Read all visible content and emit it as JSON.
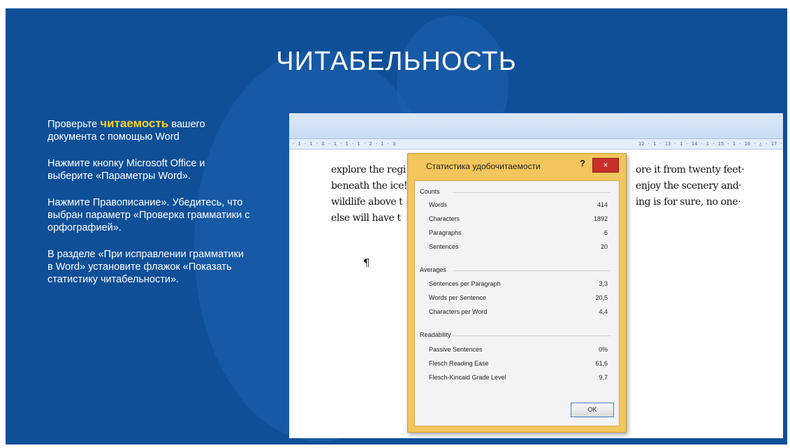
{
  "slide": {
    "title": "ЧИТАБЕЛЬНОСТЬ",
    "background_color": "#0e4f98",
    "highlight_color": "#ffd21a",
    "instructions": [
      {
        "prefix": "Проверьте ",
        "highlight": "читаемость",
        "suffix": " вашего документа с помощью Word"
      },
      {
        "text": "Нажмите кнопку Microsoft  Office и выберите «Параметры Word»."
      },
      {
        "text": "Нажмите Правописание». Убедитесь,  что выбран параметр «Проверка грамматики с орфографией»."
      },
      {
        "text": "В разделе «При исправлении грамматики в Word» установите флажок «Показать статистику читабельности»."
      }
    ]
  },
  "word": {
    "ruler_left": "· 1 · 1 · ⧖ · 1 · 1 · 1 · 2 · 1 · 3",
    "ruler_right": "12 · 1 · 13 · 1 · 14 · 1 · 15 · 1 · 16 · △ · 17 · 1 ·",
    "doc_lines_left": [
      "explore the regi",
      "beneath the ice!",
      "wildlife above t",
      "else will have t"
    ],
    "doc_lines_right": [
      "ore it from twenty feet·",
      "enjoy the scenery and·",
      "ing is for sure, no one·"
    ],
    "pilcrow": "¶"
  },
  "dialog": {
    "title": "Статистика удобочитаемости",
    "help_label": "?",
    "close_label": "×",
    "sections": [
      {
        "name": "Counts",
        "rows": [
          {
            "label": "Words",
            "value": "414"
          },
          {
            "label": "Characters",
            "value": "1892"
          },
          {
            "label": "Paragraphs",
            "value": "6"
          },
          {
            "label": "Sentences",
            "value": "20"
          }
        ]
      },
      {
        "name": "Averages",
        "rows": [
          {
            "label": "Sentences per Paragraph",
            "value": "3,3"
          },
          {
            "label": "Words per Sentence",
            "value": "20,5"
          },
          {
            "label": "Characters per Word",
            "value": "4,4"
          }
        ]
      },
      {
        "name": "Readability",
        "rows": [
          {
            "label": "Passive Sentences",
            "value": "0%"
          },
          {
            "label": "Flesch Reading Ease",
            "value": "61,6"
          },
          {
            "label": "Flesch-Kincaid Grade Level",
            "value": "9,7"
          }
        ]
      }
    ],
    "ok_label": "OK"
  }
}
